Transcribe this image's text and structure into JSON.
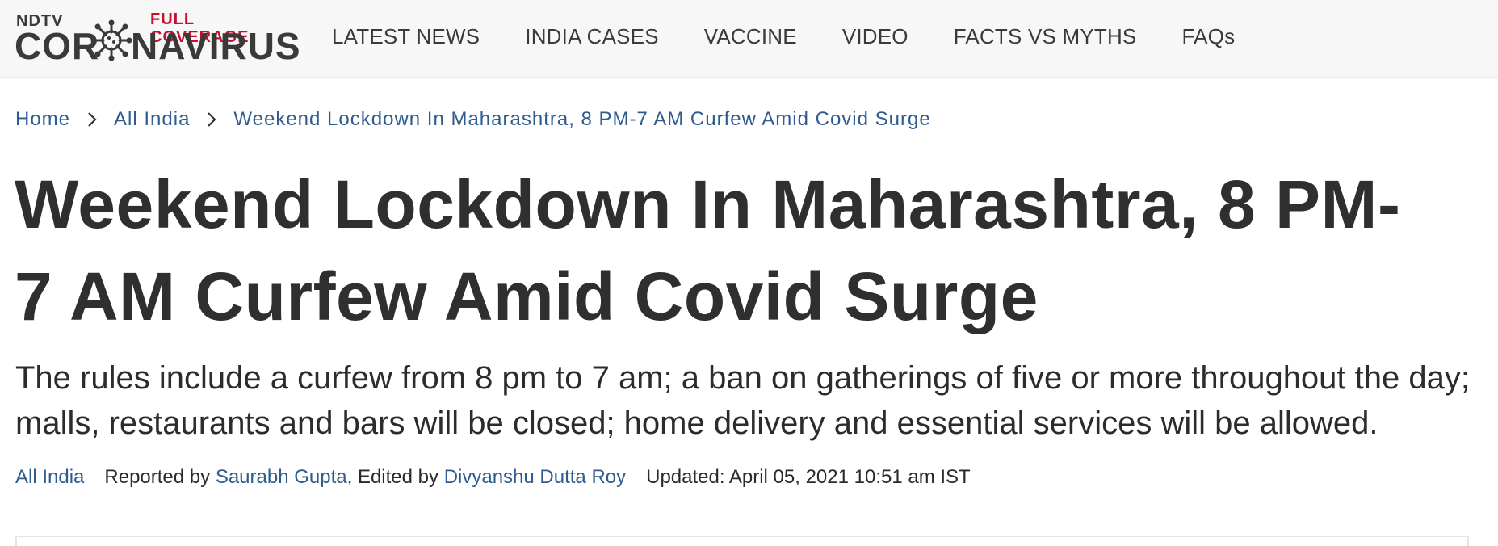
{
  "header": {
    "logo": {
      "brand": "NDTV",
      "tagline": "FULL COVERAGE",
      "title_left": "COR",
      "title_right": "NAVIRUS",
      "icon": "coronavirus-icon"
    },
    "nav": [
      {
        "label": "LATEST NEWS"
      },
      {
        "label": "INDIA CASES"
      },
      {
        "label": "VACCINE"
      },
      {
        "label": "VIDEO"
      },
      {
        "label": "FACTS VS MYTHS"
      },
      {
        "label": "FAQs"
      }
    ]
  },
  "breadcrumb": {
    "items": [
      {
        "label": "Home"
      },
      {
        "label": "All India"
      },
      {
        "label": "Weekend Lockdown In Maharashtra, 8 PM-7 AM Curfew Amid Covid Surge"
      }
    ],
    "separator_icon": "chevron-right-icon"
  },
  "article": {
    "headline": "Weekend Lockdown In Maharashtra, 8 PM-7 AM Curfew Amid Covid Surge",
    "summary": "The rules include a curfew from 8 pm to 7 am; a ban on gatherings of five or more throughout the day; malls, restaurants and bars will be closed; home delivery and essential services will be allowed.",
    "byline": {
      "category": "All India",
      "reported_prefix": "Reported by ",
      "reporter": "Saurabh Gupta",
      "edited_prefix": ", Edited by ",
      "editor": "Divyanshu Dutta Roy",
      "updated": "Updated: April 05, 2021 10:51 am IST"
    }
  },
  "colors": {
    "link": "#2f5b8f",
    "accent_red": "#c8102e",
    "header_bg": "#f7f7f7",
    "text_dark": "#2f2f2f"
  }
}
